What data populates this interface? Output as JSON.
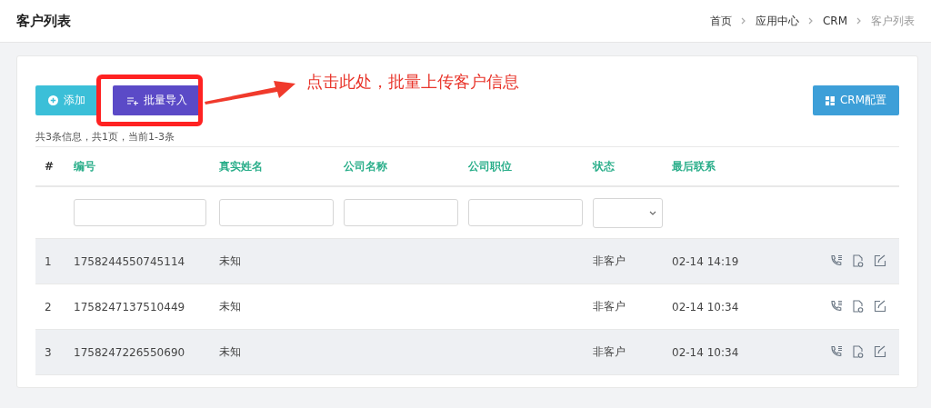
{
  "page": {
    "title": "客户列表"
  },
  "breadcrumb": [
    {
      "label": "首页",
      "current": false
    },
    {
      "label": "应用中心",
      "current": false
    },
    {
      "label": "CRM",
      "current": false
    },
    {
      "label": "客户列表",
      "current": true
    }
  ],
  "toolbar": {
    "buttons": [
      {
        "label": "添加",
        "kind": "add"
      },
      {
        "label": "批量导入",
        "kind": "import"
      }
    ],
    "config_button": "CRM配置"
  },
  "annotation": {
    "text": "点击此处，批量上传客户信息"
  },
  "summary": "共3条信息，共1页，当前1-3条",
  "table": {
    "columns": [
      "#",
      "编号",
      "真实姓名",
      "公司名称",
      "公司职位",
      "状态",
      "最后联系"
    ],
    "filters": [
      {
        "kind": "none"
      },
      {
        "kind": "text"
      },
      {
        "kind": "text"
      },
      {
        "kind": "text"
      },
      {
        "kind": "text"
      },
      {
        "kind": "select"
      },
      {
        "kind": "none"
      }
    ],
    "rows": [
      {
        "cells": [
          "1",
          "1758244550745114",
          "未知",
          "",
          "",
          "非客户",
          "02-14 14:19"
        ]
      },
      {
        "cells": [
          "2",
          "1758247137510449",
          "未知",
          "",
          "",
          "非客户",
          "02-14 10:34"
        ]
      },
      {
        "cells": [
          "3",
          "1758247226550690",
          "未知",
          "",
          "",
          "非客户",
          "02-14 10:34"
        ]
      }
    ]
  }
}
